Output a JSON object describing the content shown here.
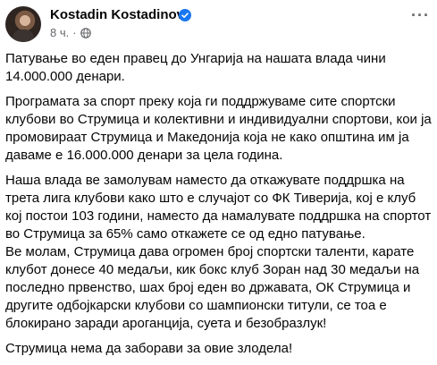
{
  "author": {
    "name": "Kostadin Kostadinov",
    "verified_icon": "verified-badge-icon",
    "verified_color": "#1877f2"
  },
  "meta": {
    "time": "8 ч.",
    "separator": "·",
    "audience_icon": "globe-icon"
  },
  "menu": {
    "more_label": "···"
  },
  "post": {
    "paragraphs": [
      "Патување во еден правец до Унгарија на нашата влада чини 14.000.000 денари.",
      "Програмата за спорт преку која ги поддржуваме сите спортски клубови во Струмица и колективни и индивидуални спортови, кои ја промовираат Струмица и Македонија која не како општина им ја даваме е 16.000.000 денари за цела година.",
      "Наша влада ве замолувам наместо да откажувате поддршка на трета лига клубови како што е случајот со ФК Тиверија, кој е клуб кој постои 103 години, наместо да намалувате поддршка на спортот во Струмица за 65% само откажете се од едно патување.",
      "Ве молам, Струмица дава огромен број спортски таленти, карате клубот донесе 40 медаљи, кик бокс клуб Зоран над 30 медаљи  на последно првенство, шах број еден во државата, ОК Струмица и другите одбојкарски клубови со шампионски титули, се тоа  е блокирано заради ароганција, суета и безобразлук!",
      "Струмица нема да заборави за овие злодела!"
    ]
  }
}
